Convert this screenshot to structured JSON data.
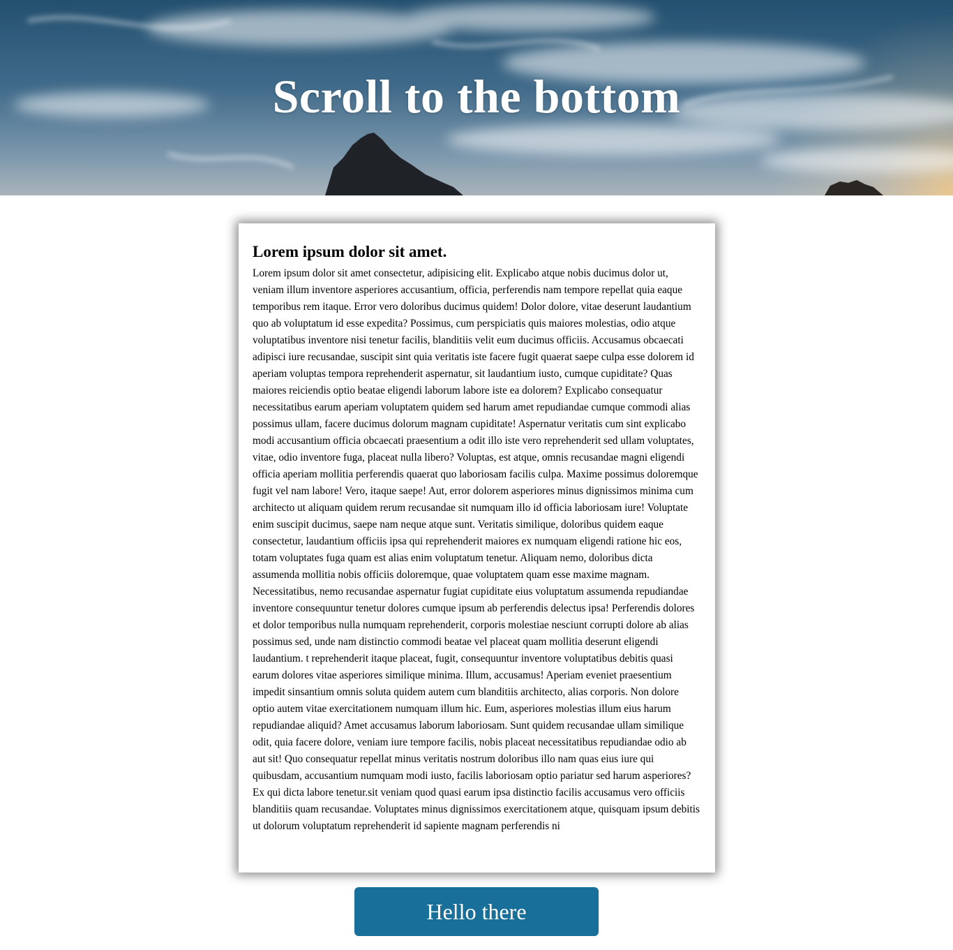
{
  "hero": {
    "title": "Scroll to the bottom"
  },
  "card": {
    "heading": "Lorem ipsum dolor sit amet.",
    "body": "Lorem ipsum dolor sit amet consectetur, adipisicing elit. Explicabo atque nobis ducimus dolor ut, veniam illum inventore asperiores accusantium, officia, perferendis nam tempore repellat quia eaque temporibus rem itaque. Error vero doloribus ducimus quidem! Dolor dolore, vitae deserunt laudantium quo ab voluptatum id esse expedita? Possimus, cum perspiciatis quis maiores molestias, odio atque voluptatibus inventore nisi tenetur facilis, blanditiis velit eum ducimus officiis. Accusamus obcaecati adipisci iure recusandae, suscipit sint quia veritatis iste facere fugit quaerat saepe culpa esse dolorem id aperiam voluptas tempora reprehenderit aspernatur, sit laudantium iusto, cumque cupiditate? Quas maiores reiciendis optio beatae eligendi laborum labore iste ea dolorem? Explicabo consequatur necessitatibus earum aperiam voluptatem quidem sed harum amet repudiandae cumque commodi alias possimus ullam, facere ducimus dolorum magnam cupiditate! Aspernatur veritatis cum sint explicabo modi accusantium officia obcaecati praesentium a odit illo iste vero reprehenderit sed ullam voluptates, vitae, odio inventore fuga, placeat nulla libero? Voluptas, est atque, omnis recusandae magni eligendi officia aperiam mollitia perferendis quaerat quo laboriosam facilis culpa. Maxime possimus doloremque fugit vel nam labore! Vero, itaque saepe! Aut, error dolorem asperiores minus dignissimos minima cum architecto ut aliquam quidem rerum recusandae sit numquam illo id officia laboriosam iure! Voluptate enim suscipit ducimus, saepe nam neque atque sunt. Veritatis similique, doloribus quidem eaque consectetur, laudantium officiis ipsa qui reprehenderit maiores ex numquam eligendi ratione hic eos, totam voluptates fuga quam est alias enim voluptatum tenetur. Aliquam nemo, doloribus dicta assumenda mollitia nobis officiis doloremque, quae voluptatem quam esse maxime magnam. Necessitatibus, nemo recusandae aspernatur fugiat cupiditate eius voluptatum assumenda repudiandae inventore consequuntur tenetur dolores cumque ipsum ab perferendis delectus ipsa! Perferendis dolores et dolor temporibus nulla numquam reprehenderit, corporis molestiae nesciunt corrupti dolore ab alias possimus sed, unde nam distinctio commodi beatae vel placeat quam mollitia deserunt eligendi laudantium. t reprehenderit itaque placeat, fugit, consequuntur inventore voluptatibus debitis quasi earum dolores vitae asperiores similique minima. Illum, accusamus! Aperiam eveniet praesentium impedit sinsantium omnis soluta quidem autem cum blanditiis architecto, alias corporis. Non dolore optio autem vitae exercitationem numquam illum hic. Eum, asperiores molestias illum eius harum repudiandae aliquid? Amet accusamus laborum laboriosam. Sunt quidem recusandae ullam similique odit, quia facere dolore, veniam iure tempore facilis, nobis placeat necessitatibus repudiandae odio ab aut sit! Quo consequatur repellat minus veritatis nostrum doloribus illo nam quas eius iure qui quibusdam, accusantium numquam modi iusto, facilis laboriosam optio pariatur sed harum asperiores? Ex qui dicta labore tenetur.sit veniam quod quasi earum ipsa distinctio facilis accusamus vero officiis blanditiis quam recusandae. Voluptates minus dignissimos exercitationem atque, quisquam ipsum debitis ut dolorum voluptatum reprehenderit id sapiente magnam perferendis ni"
  },
  "button": {
    "label": "Hello there"
  },
  "colors": {
    "button_bg": "#186f99",
    "hero_text": "#ffffff",
    "sky": "#3e6786"
  }
}
